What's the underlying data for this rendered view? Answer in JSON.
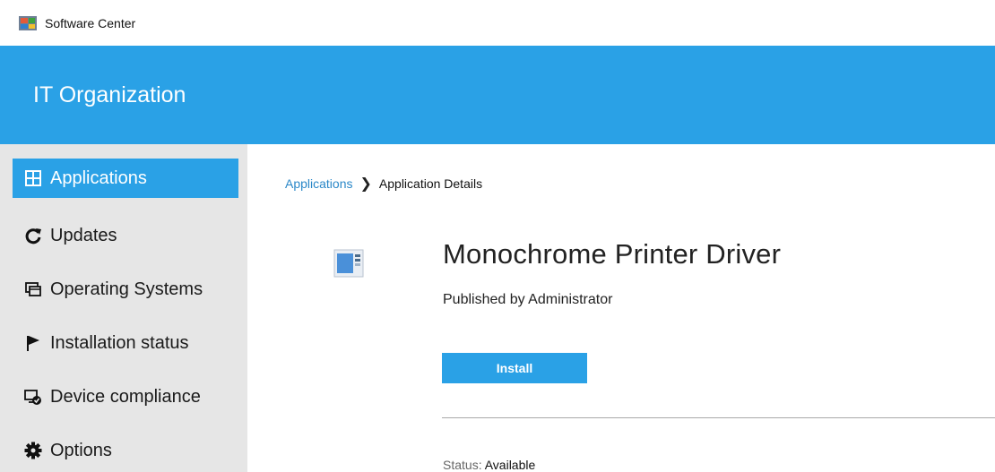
{
  "window": {
    "title": "Software Center",
    "icon": "software-center-icon"
  },
  "header": {
    "org_name": "IT Organization",
    "color": "#2aa1e6"
  },
  "sidebar": {
    "items": [
      {
        "label": "Applications",
        "icon": "applications-grid-icon",
        "active": true
      },
      {
        "label": "Updates",
        "icon": "refresh-icon",
        "active": false
      },
      {
        "label": "Operating Systems",
        "icon": "operating-systems-icon",
        "active": false
      },
      {
        "label": "Installation status",
        "icon": "flag-icon",
        "active": false
      },
      {
        "label": "Device compliance",
        "icon": "device-compliance-icon",
        "active": false
      },
      {
        "label": "Options",
        "icon": "gear-icon",
        "active": false
      }
    ]
  },
  "breadcrumb": {
    "parent": "Applications",
    "separator": "❯",
    "current": "Application Details"
  },
  "application": {
    "name": "Monochrome Printer Driver",
    "publisher": "Published by Administrator",
    "install_label": "Install",
    "status_label": "Status:",
    "status_value": "Available"
  }
}
